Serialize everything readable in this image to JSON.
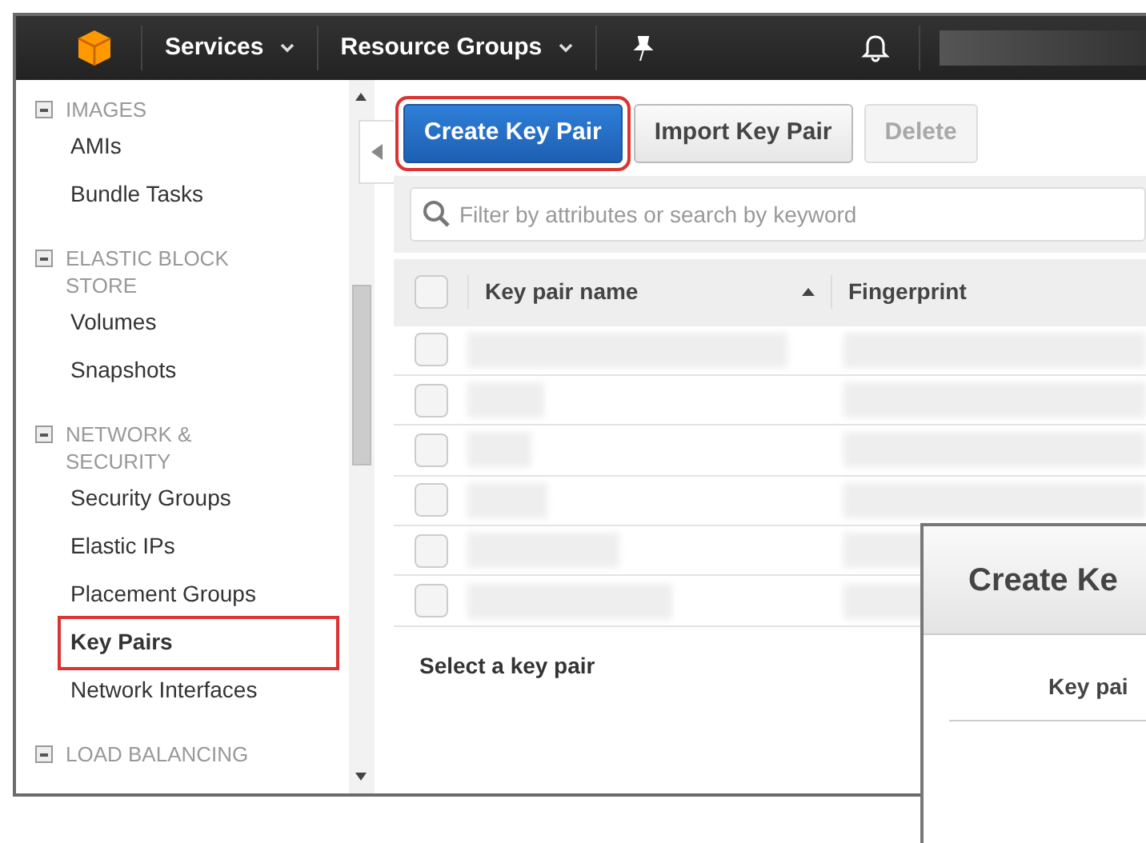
{
  "top_bar": {
    "menus": [
      {
        "label": "Services",
        "has_caret": true
      },
      {
        "label": "Resource Groups",
        "has_caret": true
      }
    ]
  },
  "sidebar": {
    "groups": [
      {
        "heading": "IMAGES",
        "expanded": true,
        "items": [
          {
            "label": "AMIs",
            "selected": false,
            "highlighted": false
          },
          {
            "label": "Bundle Tasks",
            "selected": false,
            "highlighted": false
          }
        ]
      },
      {
        "heading": "ELASTIC BLOCK STORE",
        "expanded": true,
        "items": [
          {
            "label": "Volumes",
            "selected": false,
            "highlighted": false
          },
          {
            "label": "Snapshots",
            "selected": false,
            "highlighted": false
          }
        ]
      },
      {
        "heading": "NETWORK & SECURITY",
        "expanded": true,
        "items": [
          {
            "label": "Security Groups",
            "selected": false,
            "highlighted": false
          },
          {
            "label": "Elastic IPs",
            "selected": false,
            "highlighted": false
          },
          {
            "label": "Placement Groups",
            "selected": false,
            "highlighted": false
          },
          {
            "label": "Key Pairs",
            "selected": true,
            "highlighted": true
          },
          {
            "label": "Network Interfaces",
            "selected": false,
            "highlighted": false
          }
        ]
      },
      {
        "heading": "LOAD BALANCING",
        "expanded": true
      }
    ]
  },
  "actions": [
    {
      "label": "Create Key Pair",
      "kind": "primary",
      "disabled": false,
      "highlighted": true
    },
    {
      "label": "Import Key Pair",
      "kind": "default",
      "disabled": false,
      "highlighted": false
    },
    {
      "label": "Delete",
      "kind": "default",
      "disabled": true,
      "highlighted": false
    }
  ],
  "search": {
    "placeholder": "Filter by attributes or search by keyword"
  },
  "table": {
    "columns": [
      {
        "label": "Key pair name",
        "sort_ascending": true
      },
      {
        "label": "Fingerprint"
      }
    ],
    "all_checked": false,
    "rows": [
      {
        "checked": false
      },
      {
        "checked": false
      },
      {
        "checked": false
      },
      {
        "checked": false
      },
      {
        "checked": false
      },
      {
        "checked": false
      }
    ]
  },
  "details": {
    "text": "Select a key pair"
  },
  "dialog": {
    "title": "Create Ke",
    "field_label": "Key pai"
  }
}
